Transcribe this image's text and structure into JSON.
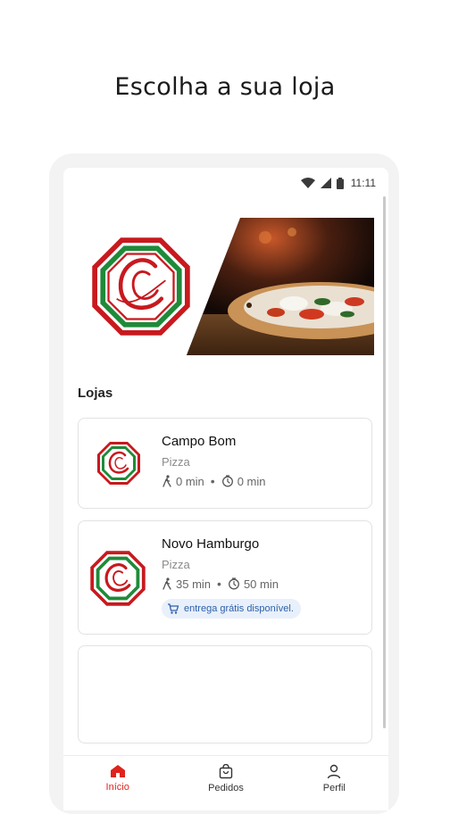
{
  "headline": "Escolha a sua loja",
  "status_bar": {
    "time": "11:11"
  },
  "section_title": "Lojas",
  "stores": [
    {
      "name": "Campo Bom",
      "category": "Pizza",
      "walk_time": "0 min",
      "delivery_time": "0 min",
      "badge": ""
    },
    {
      "name": "Novo Hamburgo",
      "category": "Pizza",
      "walk_time": "35 min",
      "delivery_time": "50 min",
      "badge": "entrega grátis disponível."
    }
  ],
  "tabs": [
    {
      "label": "Início",
      "icon": "home-icon",
      "active": true
    },
    {
      "label": "Pedidos",
      "icon": "shopping-bag-icon",
      "active": false
    },
    {
      "label": "Perfil",
      "icon": "person-icon",
      "active": false
    }
  ],
  "colors": {
    "accent": "#e0231b",
    "badge_bg": "#e8f0fb",
    "badge_text": "#2d5fa8",
    "logo_red": "#c8191e",
    "logo_green": "#1f8a3a"
  }
}
